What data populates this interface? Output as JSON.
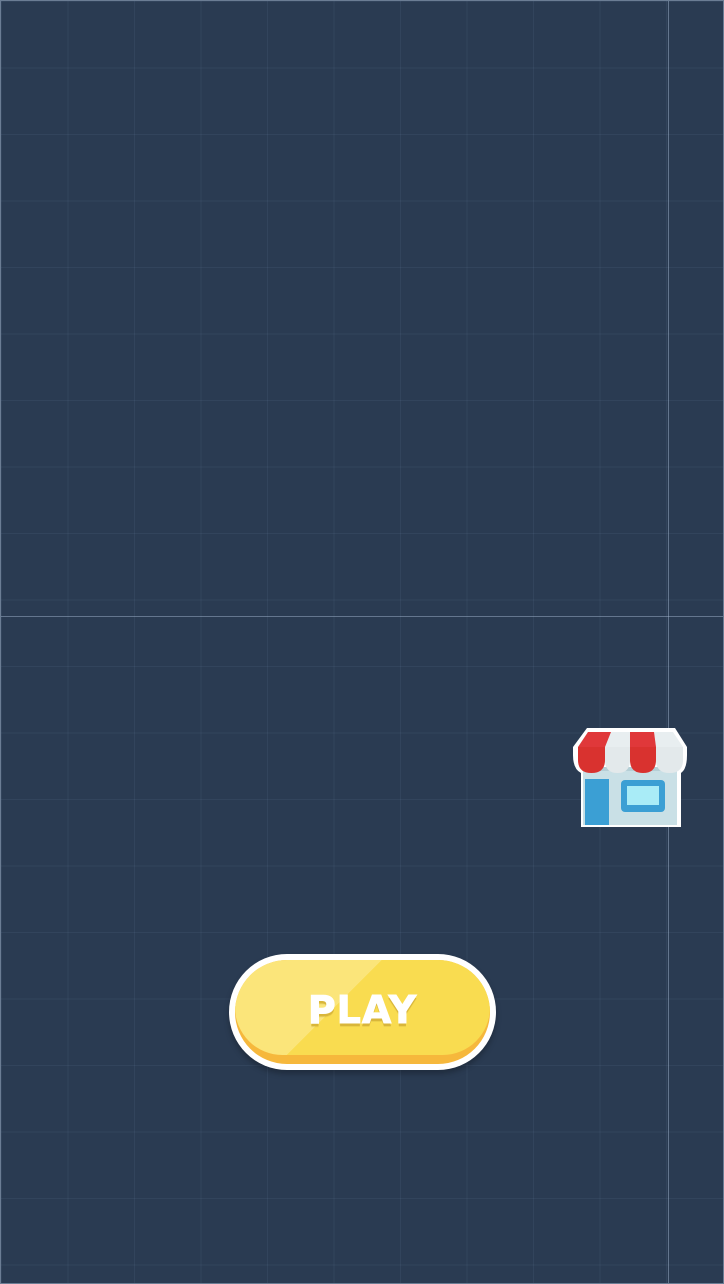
{
  "game": {
    "play_label": "PLAY",
    "shop_icon": "shop-storefront-icon"
  },
  "colors": {
    "background": "#2a3b52",
    "play_button_fill": "#f9dc50",
    "play_button_shadow": "#f6b83c",
    "shop_awning_red": "#e0383a",
    "shop_wall": "#c9e0e6",
    "shop_door": "#3b9fd4"
  }
}
